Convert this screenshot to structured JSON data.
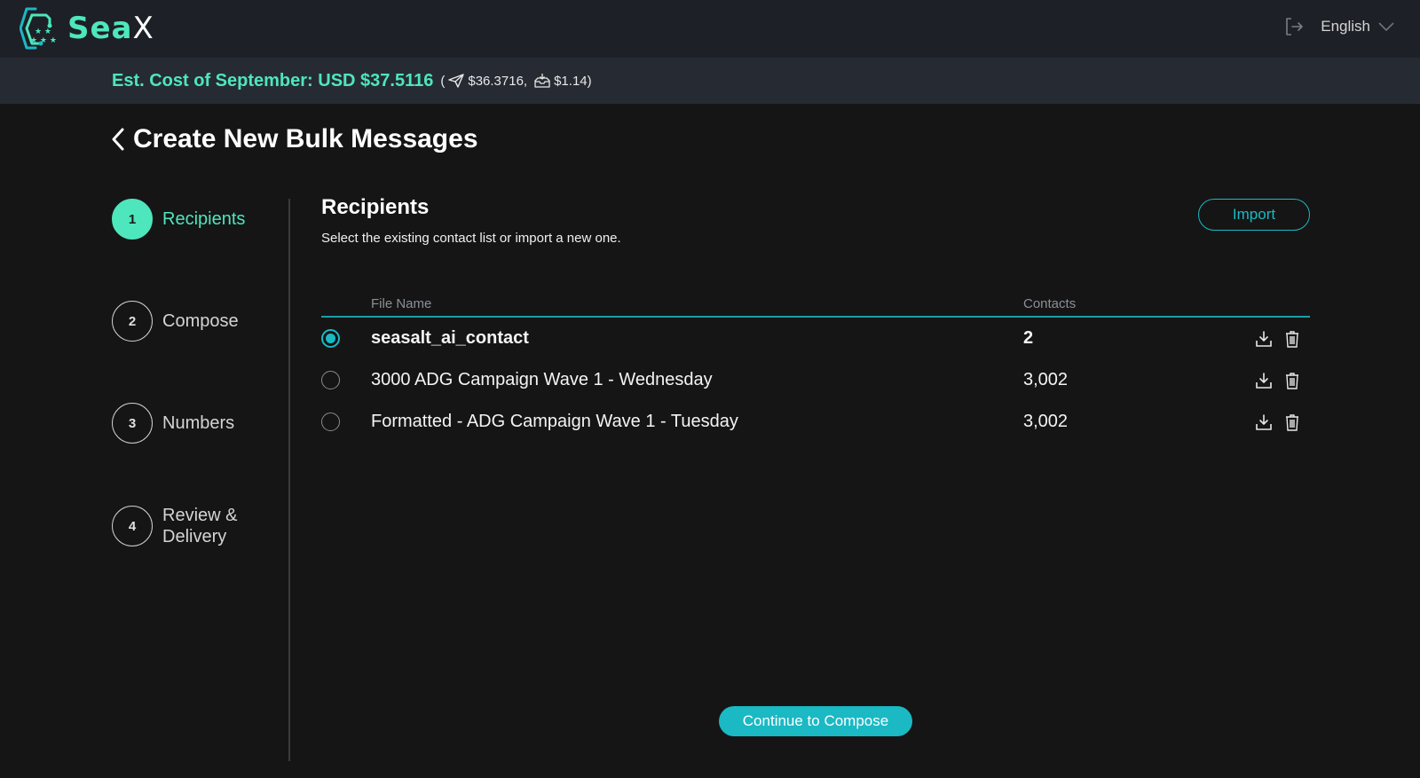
{
  "header": {
    "logo_text_a": "Sea",
    "logo_text_b": "X",
    "logout_icon": "logout-icon",
    "language": "English",
    "language_icon": "chevron-down-icon"
  },
  "cost_bar": {
    "main": "Est. Cost of September: USD $37.5116",
    "open_paren": "(",
    "outbound_icon": "paper-plane-icon",
    "outbound_amount": "$36.3716,",
    "inbound_icon": "inbox-icon",
    "inbound_amount": "$1.14)"
  },
  "page": {
    "back_icon": "chevron-left-icon",
    "title": "Create New Bulk Messages"
  },
  "steps": [
    {
      "number": "1",
      "label": "Recipients",
      "active": true
    },
    {
      "number": "2",
      "label": "Compose",
      "active": false
    },
    {
      "number": "3",
      "label": "Numbers",
      "active": false
    },
    {
      "number": "4",
      "label": "Review & Delivery",
      "active": false
    }
  ],
  "recipients": {
    "heading": "Recipients",
    "subtitle": "Select the existing contact list or import a new one.",
    "import_label": "Import",
    "columns": {
      "file_name": "File Name",
      "contacts": "Contacts"
    },
    "rows": [
      {
        "file_name": "seasalt_ai_contact",
        "contacts": "2",
        "selected": true
      },
      {
        "file_name": "3000 ADG Campaign Wave 1 - Wednesday",
        "contacts": "3,002",
        "selected": false
      },
      {
        "file_name": "Formatted - ADG Campaign Wave 1 - Tuesday",
        "contacts": "3,002",
        "selected": false
      }
    ]
  },
  "footer": {
    "continue_label": "Continue to Compose"
  },
  "colors": {
    "accent_green": "#4ee6bd",
    "accent_teal": "#1ab9c4",
    "background": "#151515",
    "topbar": "#1d2026",
    "costbar": "#262b33"
  }
}
